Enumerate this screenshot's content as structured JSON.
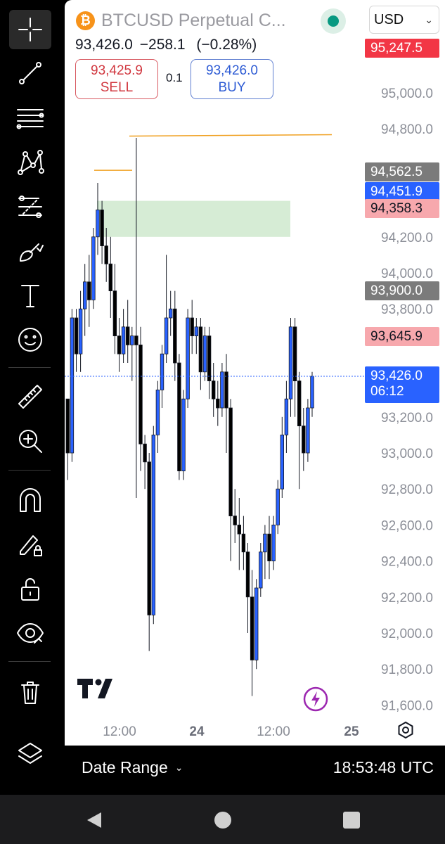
{
  "header": {
    "symbol_name": "BTCUSD Perpetual C...",
    "currency": "USD",
    "btc_glyph": "₿"
  },
  "quote": {
    "last": "93,426.0",
    "change": "−258.1",
    "change_pct": "(−0.28%)"
  },
  "trade": {
    "sell_price": "93,425.9",
    "sell_label": "SELL",
    "lot": "0.1",
    "buy_price": "93,426.0",
    "buy_label": "BUY"
  },
  "price_axis": {
    "ticks": [
      "95,000.0",
      "94,800.0",
      "94,200.0",
      "94,000.0",
      "93,800.0",
      "93,200.0",
      "93,000.0",
      "92,800.0",
      "92,600.0",
      "92,400.0",
      "92,200.0",
      "92,000.0",
      "91,800.0",
      "91,600.0"
    ]
  },
  "time_axis": {
    "ticks": [
      {
        "label": "12:00",
        "bold": false
      },
      {
        "label": "24",
        "bold": true
      },
      {
        "label": "12:00",
        "bold": false
      },
      {
        "label": "25",
        "bold": true
      }
    ]
  },
  "price_tags": [
    {
      "label": "95,247.5",
      "color": "#f23645"
    },
    {
      "label": "94,562.5",
      "color": "#7b7b7b"
    },
    {
      "label": "94,451.9",
      "color": "#2962ff"
    },
    {
      "label": "94,358.3",
      "color": "#f7a8ad",
      "text_color": "#131722"
    },
    {
      "label": "93,900.0",
      "color": "#7b7b7b"
    },
    {
      "label": "93,645.9",
      "color": "#f7a8ad",
      "text_color": "#131722"
    }
  ],
  "current_price_tag": {
    "price": "93,426.0",
    "countdown": "06:12",
    "color": "#2962ff"
  },
  "colors": {
    "up_candle": "#2962ff",
    "down_candle": "#000000",
    "zone": "#d6ecd5",
    "level_line": "#f0a020"
  },
  "bottom_bar": {
    "date_range_label": "Date Range",
    "utc_time": "18:53:48 UTC"
  },
  "icons": {
    "toolbar": [
      "crosshair-icon",
      "trend-line-icon",
      "fib-lines-icon",
      "pattern-icon",
      "forecast-icon",
      "brush-icon",
      "text-icon",
      "emoji-icon",
      "ruler-icon",
      "zoom-in-icon",
      "magnet-icon",
      "lock-drawing-icon",
      "unlock-icon",
      "eye-icon",
      "trash-icon",
      "layers-icon"
    ],
    "nav": [
      "back-icon",
      "home-icon",
      "recents-icon"
    ]
  },
  "chart_data": {
    "type": "candlestick",
    "symbol": "BTCUSD Perpetual C...",
    "ylim": [
      91600,
      95250
    ],
    "x_ticks": [
      "12:00",
      "24",
      "12:00",
      "25"
    ],
    "candles": [
      [
        93300,
        93000,
        92850,
        93300
      ],
      [
        93000,
        93750,
        92950,
        93800
      ],
      [
        93750,
        93550,
        93450,
        93800
      ],
      [
        93550,
        93800,
        93450,
        93900
      ],
      [
        93800,
        93950,
        93650,
        94050
      ],
      [
        93950,
        93850,
        93700,
        94100
      ],
      [
        93850,
        94200,
        93800,
        94250
      ],
      [
        94200,
        94350,
        94100,
        94500
      ],
      [
        94350,
        94150,
        94050,
        94400
      ],
      [
        94150,
        94050,
        93950,
        94250
      ],
      [
        94050,
        93900,
        93750,
        94200
      ],
      [
        93900,
        93650,
        93550,
        94050
      ],
      [
        93650,
        93550,
        93450,
        93750
      ],
      [
        93550,
        93700,
        93500,
        93800
      ],
      [
        93700,
        93600,
        93500,
        93850
      ],
      [
        93600,
        93650,
        93400,
        93700
      ],
      [
        93650,
        93600,
        92750,
        94750
      ],
      [
        93600,
        93050,
        92900,
        93700
      ],
      [
        93050,
        92950,
        92800,
        93100
      ],
      [
        92950,
        92100,
        91900,
        93000
      ],
      [
        92100,
        93100,
        92050,
        93150
      ],
      [
        93100,
        93350,
        93000,
        93400
      ],
      [
        93350,
        93550,
        93250,
        93600
      ],
      [
        93550,
        93750,
        93500,
        94100
      ],
      [
        93750,
        93800,
        93650,
        93900
      ],
      [
        93800,
        93500,
        93400,
        93900
      ],
      [
        93500,
        92900,
        92850,
        93550
      ],
      [
        92900,
        93300,
        92850,
        93350
      ],
      [
        93300,
        93750,
        93250,
        93800
      ],
      [
        93750,
        93650,
        93550,
        93850
      ],
      [
        93650,
        93700,
        93550,
        93750
      ],
      [
        93700,
        93450,
        93350,
        93750
      ],
      [
        93450,
        93650,
        93400,
        93700
      ],
      [
        93650,
        93400,
        93300,
        93700
      ],
      [
        93400,
        93300,
        93200,
        93500
      ],
      [
        93300,
        93250,
        93150,
        93400
      ],
      [
        93250,
        93450,
        93200,
        93500
      ],
      [
        93450,
        93250,
        93000,
        93550
      ],
      [
        93250,
        92650,
        92400,
        93300
      ],
      [
        92650,
        92600,
        92500,
        92800
      ],
      [
        92600,
        92550,
        92350,
        92750
      ],
      [
        92550,
        92450,
        92350,
        92650
      ],
      [
        92450,
        92200,
        92000,
        92500
      ],
      [
        92200,
        91850,
        91650,
        92350
      ],
      [
        91850,
        92250,
        91800,
        92300
      ],
      [
        92250,
        92450,
        92200,
        92500
      ],
      [
        92450,
        92550,
        92300,
        92600
      ],
      [
        92550,
        92400,
        92300,
        92650
      ],
      [
        92400,
        92600,
        92350,
        92650
      ],
      [
        92600,
        92800,
        92550,
        92850
      ],
      [
        92800,
        93100,
        92750,
        93200
      ],
      [
        93100,
        93300,
        93000,
        93400
      ],
      [
        93300,
        93700,
        93200,
        93750
      ],
      [
        93700,
        93400,
        93200,
        93750
      ],
      [
        93400,
        93150,
        92800,
        93450
      ],
      [
        93150,
        93000,
        92900,
        93250
      ],
      [
        93000,
        93250,
        92950,
        93300
      ],
      [
        93250,
        93426,
        93200,
        93450
      ]
    ],
    "zones": [
      {
        "from": 94200,
        "to": 94400
      }
    ],
    "levels": [
      94760,
      94570
    ]
  }
}
